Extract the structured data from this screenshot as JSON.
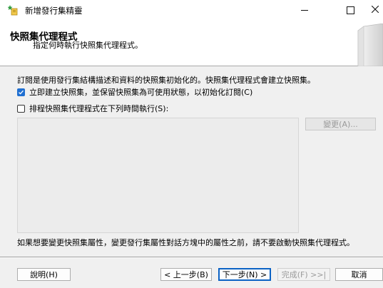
{
  "window": {
    "title": "新增發行集精靈",
    "minimize": "—",
    "maximize": "☐",
    "close": "✕"
  },
  "header": {
    "title": "快照集代理程式",
    "subtitle": "指定何時執行快照集代理程式。"
  },
  "main": {
    "description": "訂閱是使用發行集結構描述和資料的快照集初始化的。快照集代理程式會建立快照集。",
    "option_immediate": {
      "label": "立即建立快照集，並保留快照集為可使用狀態，以初始化訂閱(C)",
      "checked": true
    },
    "option_schedule": {
      "label": "排程快照集代理程式在下列時間執行(S):",
      "checked": false
    },
    "change_button": "變更(A)...",
    "note": "如果想要變更快照集屬性，變更發行集屬性對話方塊中的屬性之前，請不要啟動快照集代理程式。"
  },
  "footer": {
    "help": "說明(H)",
    "back": "< 上一步(B)",
    "next": "下一步(N) >",
    "finish": "完成(F) >>|",
    "cancel": "取消"
  },
  "colors": {
    "accent": "#1f6fd1",
    "primary_border": "#0b62c4"
  }
}
